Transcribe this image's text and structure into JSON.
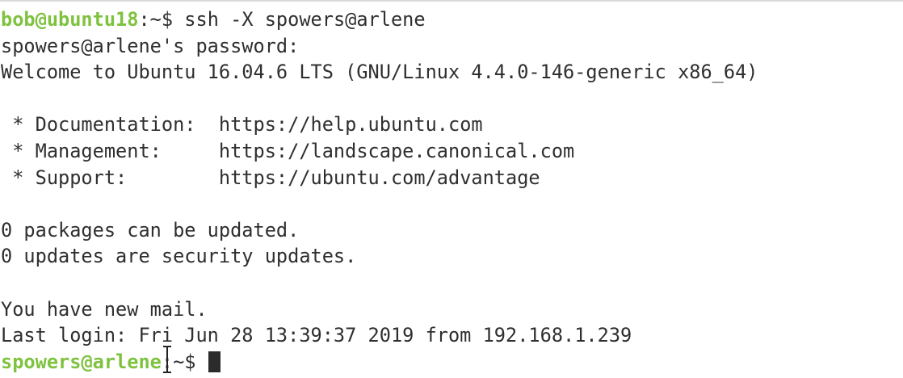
{
  "session": {
    "local_prompt_user": "bob@ubuntu18",
    "local_prompt_path": ":~$ ",
    "command": "ssh -X spowers@arlene",
    "password_prompt": "spowers@arlene's password:",
    "welcome": "Welcome to Ubuntu 16.04.6 LTS (GNU/Linux 4.4.0-146-generic x86_64)",
    "links": [
      {
        "label": " * Documentation:  ",
        "url": "https://help.ubuntu.com"
      },
      {
        "label": " * Management:     ",
        "url": "https://landscape.canonical.com"
      },
      {
        "label": " * Support:        ",
        "url": "https://ubuntu.com/advantage"
      }
    ],
    "packages_line": "0 packages can be updated.",
    "security_line": "0 updates are security updates.",
    "mail_line": "You have new mail.",
    "last_login": "Last login: Fri Jun 28 13:39:37 2019 from 192.168.1.239",
    "remote_prompt_user": "spowers@arlene",
    "remote_prompt_path": ":~$ "
  },
  "colors": {
    "prompt_user": "#7fc23f",
    "text": "#2f2f2f",
    "background": "#ffffff"
  },
  "icons": {
    "mouse_pointer": "i-beam-icon"
  }
}
